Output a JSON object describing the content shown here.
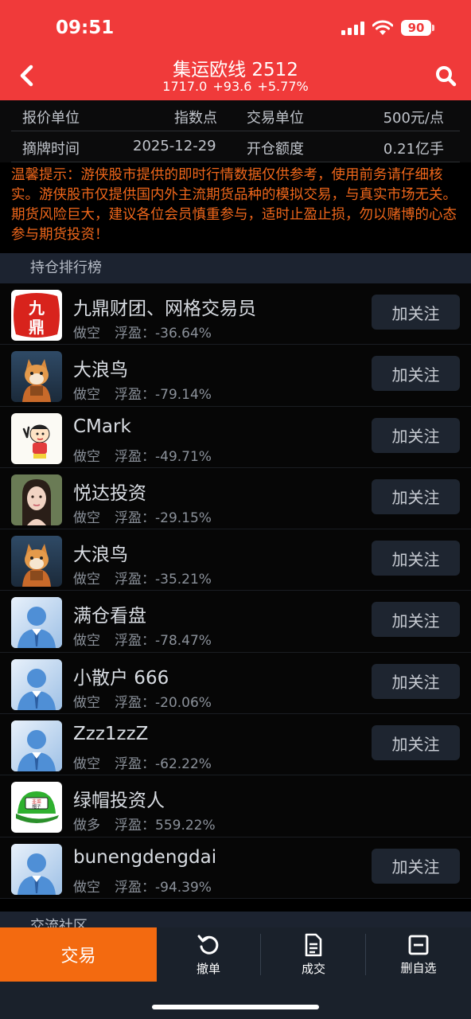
{
  "status": {
    "time": "09:51",
    "battery": "90"
  },
  "header": {
    "title": "集运欧线 2512",
    "subtitle": "1717.0  +93.6  +5.77%"
  },
  "info": {
    "row1": {
      "k1": "报价单位",
      "v1": "指数点",
      "k2": "交易单位",
      "v2": "500元/点"
    },
    "row2": {
      "k1": "摘牌时间",
      "v1": "2025-12-29",
      "k2": "开仓额度",
      "v2": "0.21亿手"
    }
  },
  "warning": "温馨提示：游侠股市提供的即时行情数据仅供参考，使用前务请仔细核实。游侠股市仅提供国内外主流期货品种的模拟交易，与真实市场无关。期货风险巨大，建议各位会员慎重参与，适时止盈止损，勿以赌博的心态参与期货投资！",
  "ranking": {
    "title": "持仓排行榜",
    "float_label": "浮盈：",
    "items": [
      {
        "name": "九鼎财团、网格交易员",
        "direction": "做空",
        "pnl": "-36.64%",
        "follow": "加关注",
        "avatar": "jiuding-logo"
      },
      {
        "name": "大浪鸟",
        "direction": "做空",
        "pnl": "-79.14%",
        "follow": "加关注",
        "avatar": "shiba-photo"
      },
      {
        "name": "CMark",
        "direction": "做空",
        "pnl": "-49.71%",
        "follow": "加关注",
        "avatar": "cartoon-boy"
      },
      {
        "name": "悦达投资",
        "direction": "做空",
        "pnl": "-29.15%",
        "follow": "加关注",
        "avatar": "girl-photo"
      },
      {
        "name": "大浪鸟",
        "direction": "做空",
        "pnl": "-35.21%",
        "follow": "加关注",
        "avatar": "shiba-photo"
      },
      {
        "name": "满仓看盘",
        "direction": "做空",
        "pnl": "-78.47%",
        "follow": "加关注",
        "avatar": "default-person"
      },
      {
        "name": "小散户 666",
        "direction": "做空",
        "pnl": "-20.06%",
        "follow": "加关注",
        "avatar": "default-person"
      },
      {
        "name": "Zzz1zzZ",
        "direction": "做空",
        "pnl": "-62.22%",
        "follow": "加关注",
        "avatar": "default-person"
      },
      {
        "name": "绿帽投资人",
        "direction": "做多",
        "pnl": "559.22%",
        "follow": "",
        "avatar": "green-cap"
      },
      {
        "name": "bunengdengdai",
        "direction": "做空",
        "pnl": "-94.39%",
        "follow": "加关注",
        "avatar": "default-person"
      }
    ]
  },
  "community": {
    "title": "交流社区"
  },
  "bottom_bar": {
    "trade": "交易",
    "cancel": "撤单",
    "deals": "成交",
    "remove": "删自选"
  },
  "colors": {
    "header": "#f03a3a",
    "warning": "#f0671b",
    "trade": "#f36a10"
  }
}
